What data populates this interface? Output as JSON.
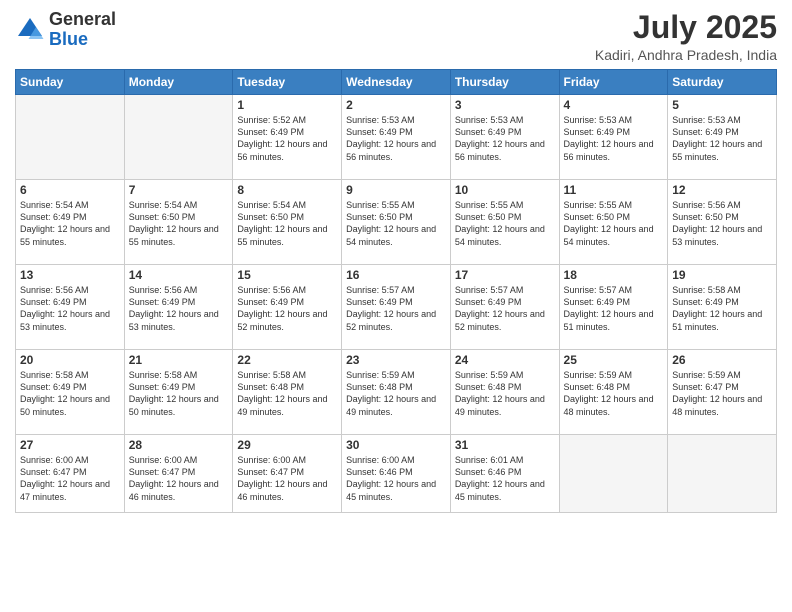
{
  "logo": {
    "general": "General",
    "blue": "Blue"
  },
  "header": {
    "month": "July 2025",
    "location": "Kadiri, Andhra Pradesh, India"
  },
  "weekdays": [
    "Sunday",
    "Monday",
    "Tuesday",
    "Wednesday",
    "Thursday",
    "Friday",
    "Saturday"
  ],
  "weeks": [
    [
      {
        "day": "",
        "info": ""
      },
      {
        "day": "",
        "info": ""
      },
      {
        "day": "1",
        "info": "Sunrise: 5:52 AM\nSunset: 6:49 PM\nDaylight: 12 hours and 56 minutes."
      },
      {
        "day": "2",
        "info": "Sunrise: 5:53 AM\nSunset: 6:49 PM\nDaylight: 12 hours and 56 minutes."
      },
      {
        "day": "3",
        "info": "Sunrise: 5:53 AM\nSunset: 6:49 PM\nDaylight: 12 hours and 56 minutes."
      },
      {
        "day": "4",
        "info": "Sunrise: 5:53 AM\nSunset: 6:49 PM\nDaylight: 12 hours and 56 minutes."
      },
      {
        "day": "5",
        "info": "Sunrise: 5:53 AM\nSunset: 6:49 PM\nDaylight: 12 hours and 55 minutes."
      }
    ],
    [
      {
        "day": "6",
        "info": "Sunrise: 5:54 AM\nSunset: 6:49 PM\nDaylight: 12 hours and 55 minutes."
      },
      {
        "day": "7",
        "info": "Sunrise: 5:54 AM\nSunset: 6:50 PM\nDaylight: 12 hours and 55 minutes."
      },
      {
        "day": "8",
        "info": "Sunrise: 5:54 AM\nSunset: 6:50 PM\nDaylight: 12 hours and 55 minutes."
      },
      {
        "day": "9",
        "info": "Sunrise: 5:55 AM\nSunset: 6:50 PM\nDaylight: 12 hours and 54 minutes."
      },
      {
        "day": "10",
        "info": "Sunrise: 5:55 AM\nSunset: 6:50 PM\nDaylight: 12 hours and 54 minutes."
      },
      {
        "day": "11",
        "info": "Sunrise: 5:55 AM\nSunset: 6:50 PM\nDaylight: 12 hours and 54 minutes."
      },
      {
        "day": "12",
        "info": "Sunrise: 5:56 AM\nSunset: 6:50 PM\nDaylight: 12 hours and 53 minutes."
      }
    ],
    [
      {
        "day": "13",
        "info": "Sunrise: 5:56 AM\nSunset: 6:49 PM\nDaylight: 12 hours and 53 minutes."
      },
      {
        "day": "14",
        "info": "Sunrise: 5:56 AM\nSunset: 6:49 PM\nDaylight: 12 hours and 53 minutes."
      },
      {
        "day": "15",
        "info": "Sunrise: 5:56 AM\nSunset: 6:49 PM\nDaylight: 12 hours and 52 minutes."
      },
      {
        "day": "16",
        "info": "Sunrise: 5:57 AM\nSunset: 6:49 PM\nDaylight: 12 hours and 52 minutes."
      },
      {
        "day": "17",
        "info": "Sunrise: 5:57 AM\nSunset: 6:49 PM\nDaylight: 12 hours and 52 minutes."
      },
      {
        "day": "18",
        "info": "Sunrise: 5:57 AM\nSunset: 6:49 PM\nDaylight: 12 hours and 51 minutes."
      },
      {
        "day": "19",
        "info": "Sunrise: 5:58 AM\nSunset: 6:49 PM\nDaylight: 12 hours and 51 minutes."
      }
    ],
    [
      {
        "day": "20",
        "info": "Sunrise: 5:58 AM\nSunset: 6:49 PM\nDaylight: 12 hours and 50 minutes."
      },
      {
        "day": "21",
        "info": "Sunrise: 5:58 AM\nSunset: 6:49 PM\nDaylight: 12 hours and 50 minutes."
      },
      {
        "day": "22",
        "info": "Sunrise: 5:58 AM\nSunset: 6:48 PM\nDaylight: 12 hours and 49 minutes."
      },
      {
        "day": "23",
        "info": "Sunrise: 5:59 AM\nSunset: 6:48 PM\nDaylight: 12 hours and 49 minutes."
      },
      {
        "day": "24",
        "info": "Sunrise: 5:59 AM\nSunset: 6:48 PM\nDaylight: 12 hours and 49 minutes."
      },
      {
        "day": "25",
        "info": "Sunrise: 5:59 AM\nSunset: 6:48 PM\nDaylight: 12 hours and 48 minutes."
      },
      {
        "day": "26",
        "info": "Sunrise: 5:59 AM\nSunset: 6:47 PM\nDaylight: 12 hours and 48 minutes."
      }
    ],
    [
      {
        "day": "27",
        "info": "Sunrise: 6:00 AM\nSunset: 6:47 PM\nDaylight: 12 hours and 47 minutes."
      },
      {
        "day": "28",
        "info": "Sunrise: 6:00 AM\nSunset: 6:47 PM\nDaylight: 12 hours and 46 minutes."
      },
      {
        "day": "29",
        "info": "Sunrise: 6:00 AM\nSunset: 6:47 PM\nDaylight: 12 hours and 46 minutes."
      },
      {
        "day": "30",
        "info": "Sunrise: 6:00 AM\nSunset: 6:46 PM\nDaylight: 12 hours and 45 minutes."
      },
      {
        "day": "31",
        "info": "Sunrise: 6:01 AM\nSunset: 6:46 PM\nDaylight: 12 hours and 45 minutes."
      },
      {
        "day": "",
        "info": ""
      },
      {
        "day": "",
        "info": ""
      }
    ]
  ]
}
